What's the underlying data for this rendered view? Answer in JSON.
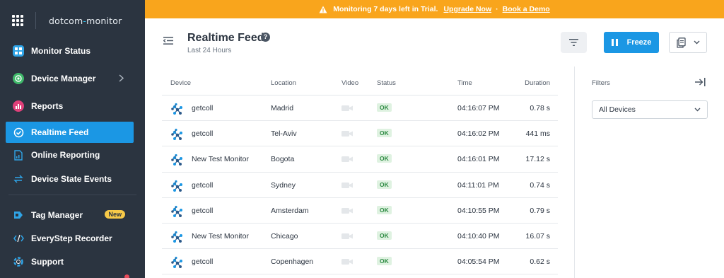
{
  "brand": {
    "name_main": "dotcom",
    "name_sep": "-",
    "name_tail": "monitor"
  },
  "sidebar": {
    "items": [
      {
        "label": "Monitor Status",
        "icon": "dashboard-icon",
        "color": "#2fa4e7"
      },
      {
        "label": "Device Manager",
        "icon": "target-icon",
        "color": "#3fb86a",
        "has_submenu": true
      },
      {
        "label": "Reports",
        "icon": "chart-icon",
        "color": "#e0407a"
      },
      {
        "label": "Realtime Feed",
        "icon": "clock-check-icon",
        "active": true
      },
      {
        "label": "Online Reporting",
        "icon": "document-chart-icon"
      },
      {
        "label": "Device State Events",
        "icon": "swap-icon"
      },
      {
        "label": "Tag Manager",
        "icon": "tag-icon",
        "badge": "New"
      },
      {
        "label": "EveryStep Recorder",
        "icon": "code-icon"
      },
      {
        "label": "Support",
        "icon": "lifebuoy-icon"
      }
    ]
  },
  "banner": {
    "message": "Monitoring 7 days left in Trial.",
    "upgrade_label": "Upgrade Now",
    "separator": "·",
    "demo_label": "Book a Demo",
    "color": "#f9a51c"
  },
  "header": {
    "title": "Realtime Feed",
    "help": "?",
    "subtitle": "Last 24 Hours",
    "freeze_label": "Freeze",
    "accent": "#1b97e4"
  },
  "table": {
    "columns": [
      "Device",
      "Location",
      "Video",
      "Status",
      "Time",
      "Duration"
    ],
    "rows": [
      {
        "device": "getcoll",
        "location": "Madrid",
        "status": "OK",
        "time": "04:16:07 PM",
        "duration": "0.78 s"
      },
      {
        "device": "getcoll",
        "location": "Tel-Aviv",
        "status": "OK",
        "time": "04:16:02 PM",
        "duration": "441 ms"
      },
      {
        "device": "New Test Monitor",
        "location": "Bogota",
        "status": "OK",
        "time": "04:16:01 PM",
        "duration": "17.12 s"
      },
      {
        "device": "getcoll",
        "location": "Sydney",
        "status": "OK",
        "time": "04:11:01 PM",
        "duration": "0.74 s"
      },
      {
        "device": "getcoll",
        "location": "Amsterdam",
        "status": "OK",
        "time": "04:10:55 PM",
        "duration": "0.79 s"
      },
      {
        "device": "New Test Monitor",
        "location": "Chicago",
        "status": "OK",
        "time": "04:10:40 PM",
        "duration": "16.07 s"
      },
      {
        "device": "getcoll",
        "location": "Copenhagen",
        "status": "OK",
        "time": "04:05:54 PM",
        "duration": "0.62 s"
      }
    ]
  },
  "filters": {
    "title": "Filters",
    "select_value": "All Devices"
  }
}
